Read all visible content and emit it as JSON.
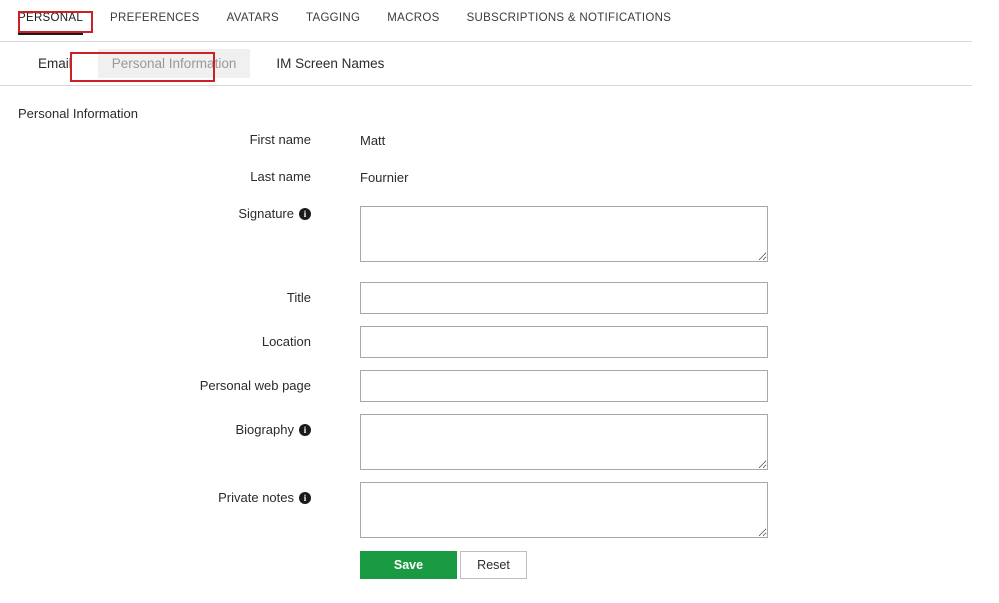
{
  "primary_tabs": [
    {
      "label": "PERSONAL",
      "active": true
    },
    {
      "label": "PREFERENCES",
      "active": false
    },
    {
      "label": "AVATARS",
      "active": false
    },
    {
      "label": "TAGGING",
      "active": false
    },
    {
      "label": "MACROS",
      "active": false
    },
    {
      "label": "SUBSCRIPTIONS & NOTIFICATIONS",
      "active": false
    }
  ],
  "secondary_tabs": [
    {
      "label": "Email",
      "selected": false
    },
    {
      "label": "Personal Information",
      "selected": true
    },
    {
      "label": "IM Screen Names",
      "selected": false
    }
  ],
  "section": {
    "heading": "Personal Information"
  },
  "fields": {
    "first_name": {
      "label": "First name",
      "value": "Matt"
    },
    "last_name": {
      "label": "Last name",
      "value": "Fournier"
    },
    "signature": {
      "label": "Signature",
      "value": "",
      "placeholder": "",
      "info": true,
      "info_glyph": "i"
    },
    "title": {
      "label": "Title",
      "value": "",
      "placeholder": ""
    },
    "location": {
      "label": "Location",
      "value": "",
      "placeholder": ""
    },
    "web_page": {
      "label": "Personal web page",
      "value": "",
      "placeholder": ""
    },
    "biography": {
      "label": "Biography",
      "value": "",
      "placeholder": "",
      "info": true,
      "info_glyph": "i"
    },
    "private_notes": {
      "label": "Private notes",
      "value": "",
      "placeholder": "",
      "info": true,
      "info_glyph": "i"
    }
  },
  "buttons": {
    "save": "Save",
    "reset": "Reset"
  },
  "colors": {
    "save_green": "#199a42",
    "annotation_red": "#cc2027",
    "selected_tab_bg": "#f0f0f0",
    "selected_tab_text": "#999999",
    "border_gray": "#a8a8a8",
    "rule_gray": "#d8d8d8",
    "text": "#2b2b2b"
  },
  "annotations": [
    {
      "name": "personal-tab-highlight",
      "target": "PERSONAL"
    },
    {
      "name": "personal-information-tab-highlight",
      "target": "Personal Information"
    }
  ]
}
